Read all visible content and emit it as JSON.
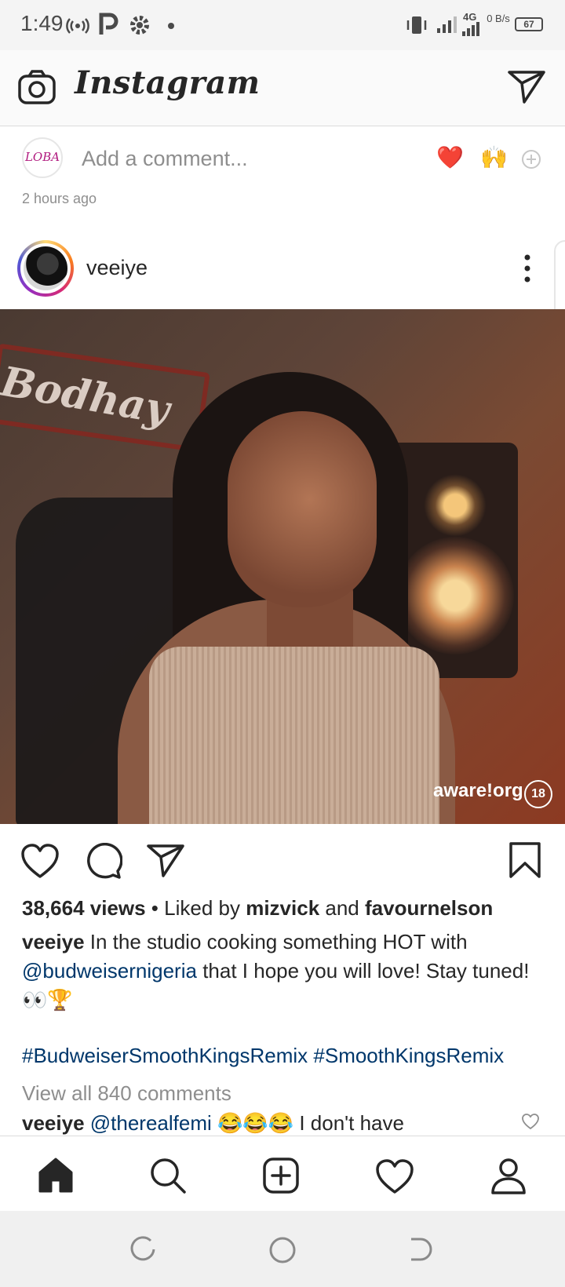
{
  "status_bar": {
    "time": "1:49",
    "network": "4G",
    "data_rate": "0 B/s",
    "battery": "67"
  },
  "header": {
    "brand": "Instagram"
  },
  "comment_row": {
    "avatar_text": "LOBA",
    "placeholder": "Add a comment...",
    "reaction_heart": "❤️",
    "reaction_hands": "🙌",
    "time_ago": "2 hours ago"
  },
  "post": {
    "username": "veeiye",
    "media": {
      "sign_text": "Bodhay",
      "watermark": "aware!org",
      "age_badge": "18"
    },
    "views": "38,664 views",
    "liked_by_prefix": " • Liked by ",
    "liked_user_1": "mizvick",
    "liked_and": " and ",
    "liked_user_2": "favournelson",
    "caption_user": "veeiye",
    "caption_text_1": " In the studio cooking something HOT with ",
    "caption_mention": "@budweisernigeria",
    "caption_text_2": " that I hope you will love!  Stay tuned! 👀🏆",
    "hashtags": "#BudweiserSmoothKingsRemix #SmoothKingsRemix",
    "view_all_comments": "View all 840 comments",
    "comment_user": "veeiye",
    "comment_mention": "@therealfemi",
    "comment_text": " 😂😂😂 I don't have"
  },
  "icons": {
    "camera": "camera-icon",
    "direct": "paper-plane-icon",
    "like": "heart-outline-icon",
    "comment": "speech-bubble-icon",
    "share": "paper-plane-icon",
    "save": "bookmark-icon",
    "home": "home-icon",
    "search": "search-icon",
    "new_post": "plus-square-icon",
    "activity": "heart-outline-icon",
    "profile": "user-icon"
  },
  "colors": {
    "link": "#00376b",
    "text": "#262626",
    "muted": "#8e8e8e",
    "heart": "#ed4956"
  }
}
